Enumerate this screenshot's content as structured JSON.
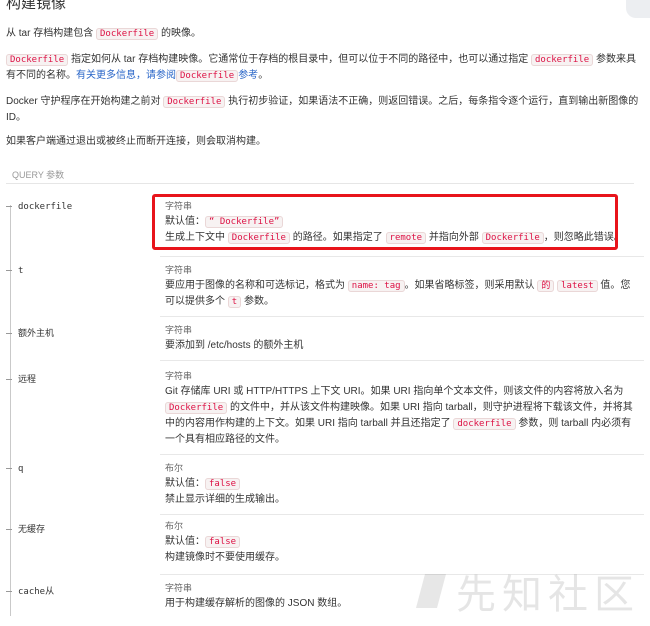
{
  "title": "构建镜像",
  "intro": {
    "p1": [
      "从 tar 存档构建包含 ",
      "Dockerfile",
      " 的映像。"
    ],
    "p2": {
      "code1": "Dockerfile",
      "text1": " 指定如何从 tar 存档构建映像。它通常位于存档的根目录中，但可以位于不同的路径中，也可以通过指定 ",
      "code2": "dockerfile",
      "text2": " 参数来具有不同的名称。",
      "link1": "有关更多信息，请参阅",
      "code3": "Dockerfile",
      "link2": "参考",
      "text3": "。"
    },
    "p3": [
      "Docker 守护程序在开始构建之前对 ",
      "Dockerfile",
      " 执行初步验证，如果语法不正确，则返回错误。之后，每条指令逐个运行，直到输出新图像的 ID。"
    ],
    "p4": "如果客户端通过退出或被终止而断开连接，则会取消构建。"
  },
  "query_header": "QUERY 参数",
  "params": [
    {
      "name": "dockerfile",
      "type": "字符串",
      "default_label": "默认值：",
      "default_value": "“ Dockerfile”",
      "desc": [
        "生成上下文中 ",
        "Dockerfile",
        " 的路径。如果指定了 ",
        "remote",
        " 并指向外部 ",
        "Dockerfile",
        "，则忽略此错误。"
      ]
    },
    {
      "name": "t",
      "type": "字符串",
      "desc": [
        "要应用于图像的名称和可选标记，格式为 ",
        "name: tag",
        "。如果省略标签，则采用默认 ",
        "的",
        " ",
        "latest",
        " 值。您可以提供多个 ",
        "t",
        " 参数。"
      ]
    },
    {
      "name": "额外主机",
      "type": "字符串",
      "desc": [
        "要添加到 /etc/hosts 的额外主机"
      ]
    },
    {
      "name": "远程",
      "type": "字符串",
      "desc": [
        "Git 存储库 URI 或 HTTP/HTTPS 上下文 URI。如果 URI 指向单个文本文件，则该文件的内容将放入名为 ",
        "Dockerfile",
        " 的文件中，并从该文件构建映像。如果 URI 指向 tarball，则守护进程将下载该文件，并将其中的内容用作构建的上下文。如果 URI 指向 tarball 并且还指定了 ",
        "dockerfile",
        " 参数，则 tarball 内必须有一个具有相应路径的文件。"
      ]
    },
    {
      "name": "q",
      "type": "布尔",
      "default_label": "默认值：",
      "default_value": "false",
      "desc": [
        "禁止显示详细的生成输出。"
      ]
    },
    {
      "name": "无缓存",
      "type": "布尔",
      "default_label": "默认值：",
      "default_value": "false",
      "desc": [
        "构建镜像时不要使用缓存。"
      ]
    },
    {
      "name": "cache从",
      "type": "字符串",
      "desc": [
        "用于构建缓存解析的图像的 JSON 数组。"
      ]
    }
  ],
  "watermark": "先知社区",
  "colors": {
    "highlight": "#e8141b",
    "code": "#dd1144",
    "link": "#2a66c8"
  }
}
